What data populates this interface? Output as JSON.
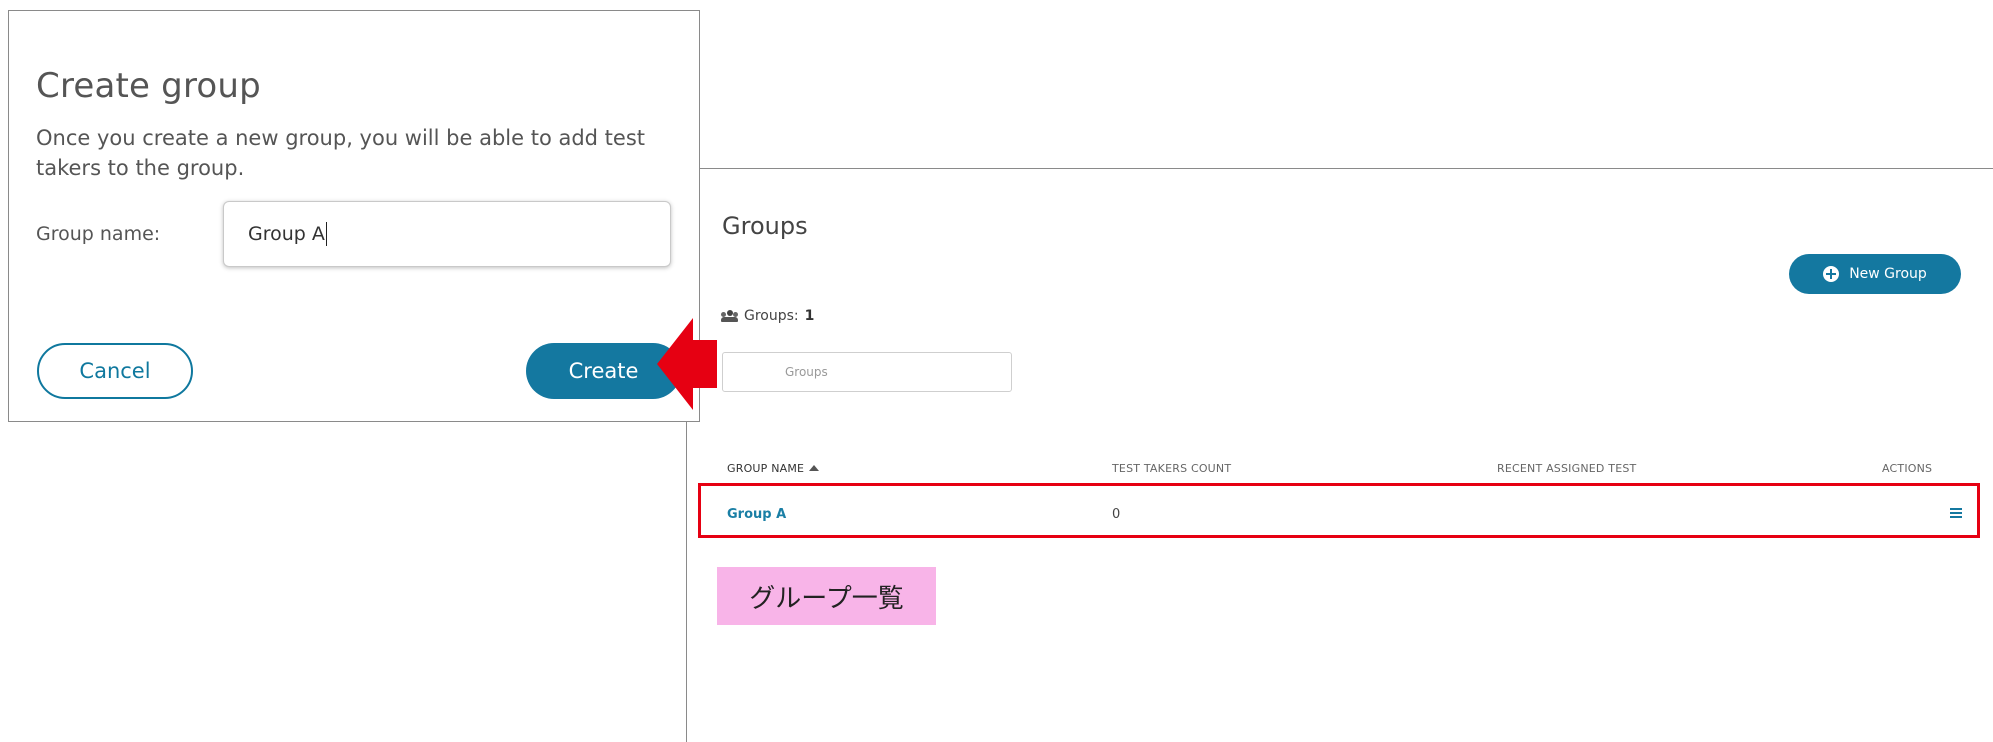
{
  "dialog": {
    "title": "Create group",
    "description": "Once you create a new group, you will be able to add test takers to the group.",
    "group_name_label": "Group name:",
    "group_name_value": "Group A",
    "cancel_label": "Cancel",
    "create_label": "Create"
  },
  "groups_page": {
    "title": "Groups",
    "new_group_label": "New Group",
    "groups_count_label": "Groups:",
    "groups_count_value": "1",
    "search_placeholder_visible": "Groups",
    "table": {
      "columns": [
        "GROUP NAME",
        "TEST TAKERS COUNT",
        "RECENT ASSIGNED TEST",
        "ACTIONS"
      ],
      "rows": [
        {
          "group_name": "Group A",
          "test_takers_count": "0",
          "recent_assigned_test": ""
        }
      ]
    }
  },
  "annotation": {
    "label": "グループ一覧",
    "highlight_color": "#e60012",
    "label_bg": "#f8b4e8"
  },
  "colors": {
    "accent": "#1478a0",
    "link": "#1a7fa5"
  },
  "icons": [
    "plus-circle-icon",
    "users-icon",
    "sort-asc-icon",
    "hamburger-menu-icon",
    "red-arrow-icon"
  ]
}
